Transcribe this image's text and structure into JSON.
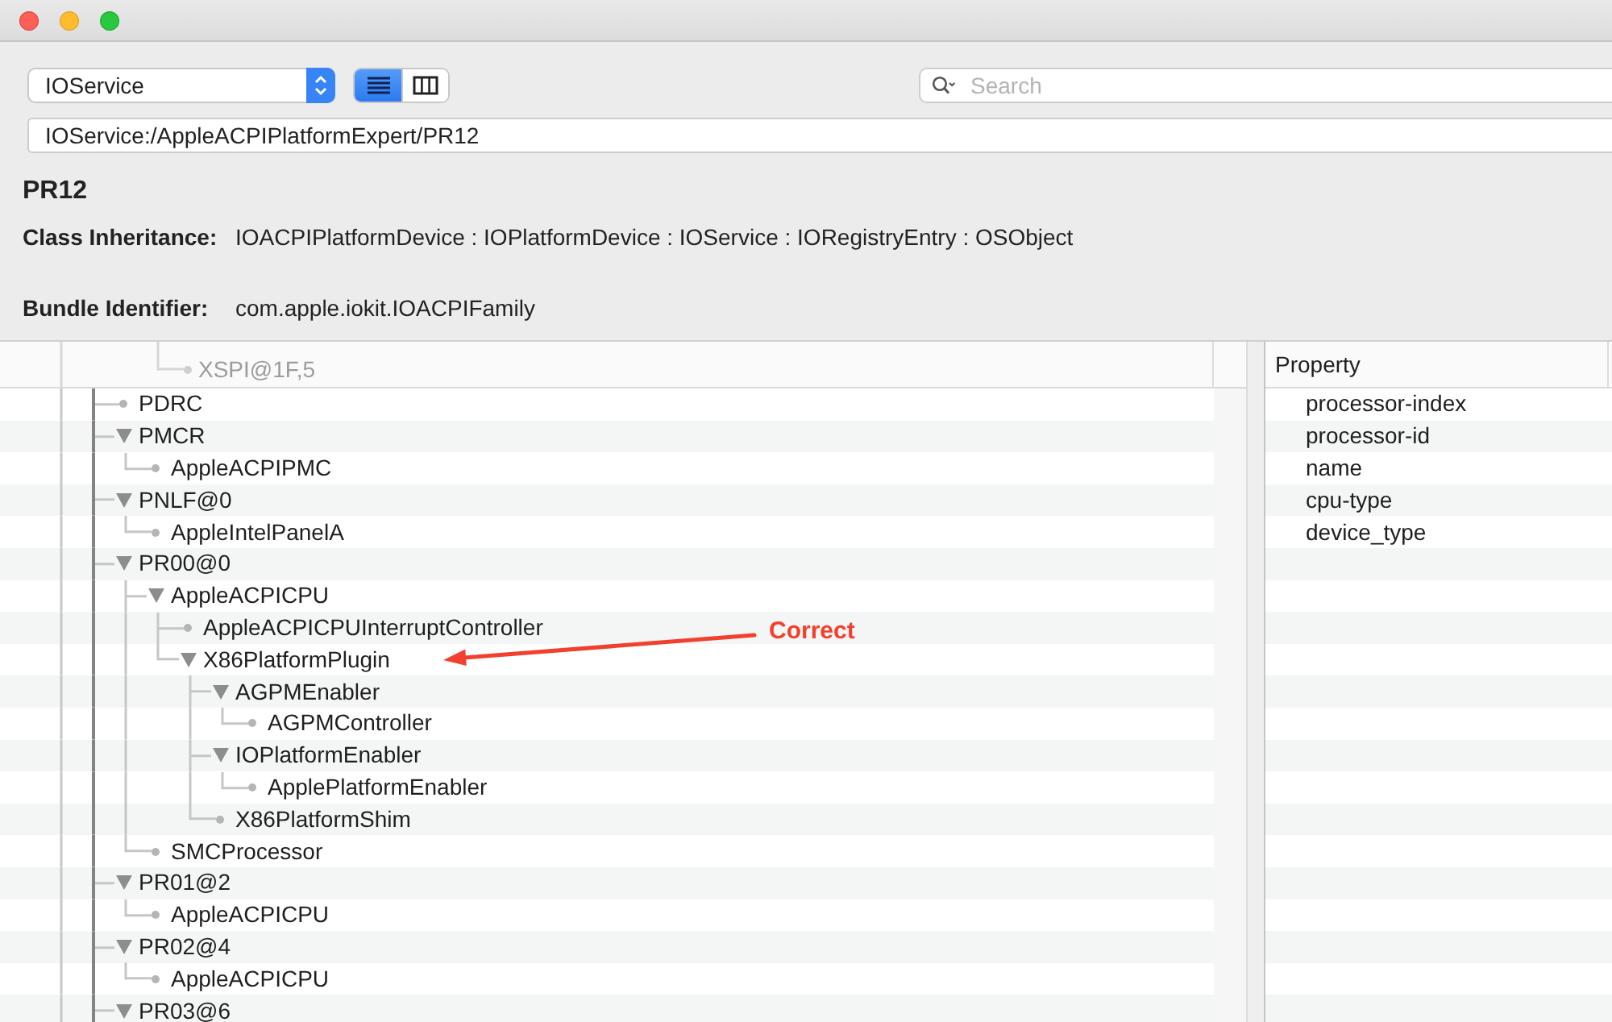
{
  "toolbar": {
    "plane_popup": {
      "value": "IOService"
    },
    "view_modes": [
      {
        "kind": "list",
        "selected": true
      },
      {
        "kind": "columns",
        "selected": false
      }
    ],
    "search": {
      "placeholder": "Search"
    }
  },
  "path_field": {
    "value": "IOService:/AppleACPIPlatformExpert/PR12"
  },
  "details": {
    "title": "PR12",
    "fields": [
      {
        "label": "Class Inheritance:",
        "value": "IOACPIPlatformDevice : IOPlatformDevice : IOService : IORegistryEntry : OSObject"
      },
      {
        "label": "Bundle Identifier:",
        "value": "com.apple.iokit.IOACPIFamily"
      }
    ]
  },
  "tree": {
    "items_under_header": [
      {
        "label": "XSPI@1F,5"
      }
    ],
    "items": [
      {
        "label": "PDRC",
        "expanded": false
      },
      {
        "label": "PMCR",
        "expanded": true,
        "children": [
          {
            "label": "AppleACPIPMC",
            "expanded": false
          }
        ]
      },
      {
        "label": "PNLF@0",
        "expanded": true,
        "children": [
          {
            "label": "AppleIntelPanelA",
            "expanded": false
          }
        ]
      },
      {
        "label": "PR00@0",
        "expanded": true,
        "children": [
          {
            "label": "AppleACPICPU",
            "expanded": true,
            "children": [
              {
                "label": "AppleACPICPUInterruptController",
                "expanded": false
              },
              {
                "label": "X86PlatformPlugin",
                "expanded": true,
                "children": [
                  {
                    "label": "AGPMEnabler",
                    "expanded": true,
                    "children": [
                      {
                        "label": "AGPMController",
                        "expanded": false
                      }
                    ]
                  },
                  {
                    "label": "IOPlatformEnabler",
                    "expanded": true,
                    "children": [
                      {
                        "label": "ApplePlatformEnabler",
                        "expanded": false
                      }
                    ]
                  },
                  {
                    "label": "X86PlatformShim",
                    "expanded": false
                  }
                ]
              }
            ]
          },
          {
            "label": "SMCProcessor",
            "expanded": false
          }
        ]
      },
      {
        "label": "PR01@2",
        "expanded": true,
        "children": [
          {
            "label": "AppleACPICPU",
            "expanded": false
          }
        ]
      },
      {
        "label": "PR02@4",
        "expanded": true,
        "children": [
          {
            "label": "AppleACPICPU",
            "expanded": false
          }
        ]
      },
      {
        "label": "PR03@6",
        "expanded": true
      }
    ]
  },
  "properties": {
    "columns": [
      "Property"
    ],
    "rows": [
      {
        "property": "processor-index"
      },
      {
        "property": "processor-id"
      },
      {
        "property": "name"
      },
      {
        "property": "cpu-type"
      },
      {
        "property": "device_type"
      }
    ]
  },
  "annotation": {
    "label": "Correct"
  }
}
